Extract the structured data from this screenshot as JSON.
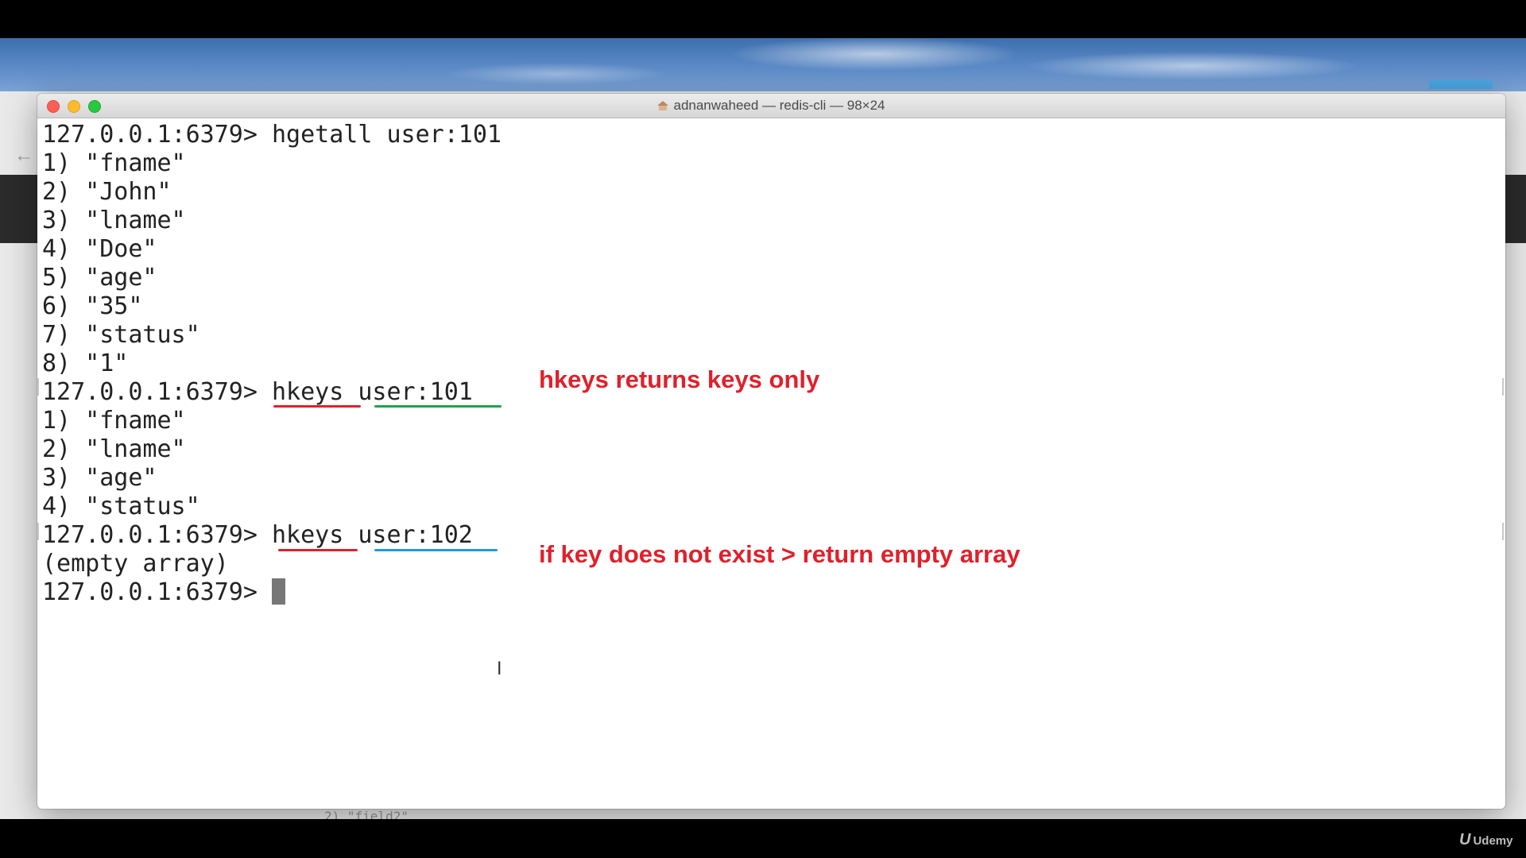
{
  "window": {
    "title": "adnanwaheed — redis-cli — 98×24"
  },
  "terminal": {
    "lines": [
      "127.0.0.1:6379> hgetall user:101",
      "1) \"fname\"",
      "2) \"John\"",
      "3) \"lname\"",
      "4) \"Doe\"",
      "5) \"age\"",
      "6) \"35\"",
      "7) \"status\"",
      "8) \"1\"",
      "127.0.0.1:6379> hkeys user:101",
      "1) \"fname\"",
      "2) \"lname\"",
      "3) \"age\"",
      "4) \"status\"",
      "127.0.0.1:6379> hkeys user:102",
      "(empty array)"
    ],
    "prompt": "127.0.0.1:6379> "
  },
  "annotations": {
    "hkeys_note": "hkeys returns keys only",
    "empty_note": "if key does not exist > return empty array",
    "colors": {
      "red": "#e0202a",
      "green": "#1fa34a",
      "blue": "#1e9bdc"
    }
  },
  "background": {
    "ghost_text": "2) \"field2\""
  },
  "branding": {
    "mark": "U",
    "name": "Udemy"
  }
}
